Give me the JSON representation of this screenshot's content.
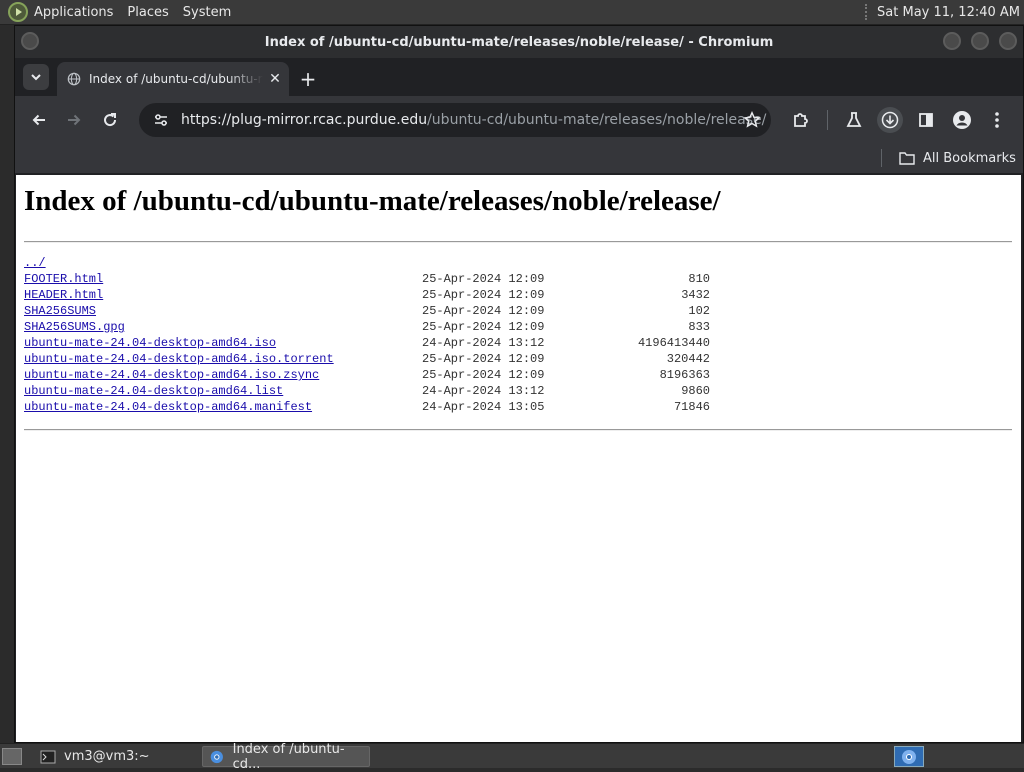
{
  "top_panel": {
    "menus": [
      "Applications",
      "Places",
      "System"
    ],
    "clock": "Sat May 11, 12:40 AM"
  },
  "window": {
    "title": "Index of /ubuntu-cd/ubuntu-mate/releases/noble/release/ - Chromium"
  },
  "tabs": [
    {
      "title": "Index of /ubuntu-cd/ubuntu-mate/releases/noble/release/",
      "icon": "globe-icon"
    }
  ],
  "toolbar": {
    "url_host": "https://plug-mirror.rcac.purdue.edu",
    "url_path": "/ubuntu-cd/ubuntu-mate/releases/noble/release/"
  },
  "bookmarks": {
    "all_label": "All Bookmarks"
  },
  "page": {
    "heading": "Index of /ubuntu-cd/ubuntu-mate/releases/noble/release/",
    "parent_link": "../",
    "entries": [
      {
        "name": "FOOTER.html",
        "date": "25-Apr-2024 12:09",
        "size": "810"
      },
      {
        "name": "HEADER.html",
        "date": "25-Apr-2024 12:09",
        "size": "3432"
      },
      {
        "name": "SHA256SUMS",
        "date": "25-Apr-2024 12:09",
        "size": "102"
      },
      {
        "name": "SHA256SUMS.gpg",
        "date": "25-Apr-2024 12:09",
        "size": "833"
      },
      {
        "name": "ubuntu-mate-24.04-desktop-amd64.iso",
        "date": "24-Apr-2024 13:12",
        "size": "4196413440"
      },
      {
        "name": "ubuntu-mate-24.04-desktop-amd64.iso.torrent",
        "date": "25-Apr-2024 12:09",
        "size": "320442"
      },
      {
        "name": "ubuntu-mate-24.04-desktop-amd64.iso.zsync",
        "date": "25-Apr-2024 12:09",
        "size": "8196363"
      },
      {
        "name": "ubuntu-mate-24.04-desktop-amd64.list",
        "date": "24-Apr-2024 13:12",
        "size": "9860"
      },
      {
        "name": "ubuntu-mate-24.04-desktop-amd64.manifest",
        "date": "24-Apr-2024 13:05",
        "size": "71846"
      }
    ]
  },
  "taskbar": {
    "tasks": [
      {
        "label": "vm3@vm3:~",
        "active": false
      },
      {
        "label": "Index of /ubuntu-cd...",
        "active": true
      }
    ]
  },
  "colors": {
    "link": "#1a0dab",
    "chrome_dark": "#35363a",
    "panel": "#3a3a3a"
  }
}
